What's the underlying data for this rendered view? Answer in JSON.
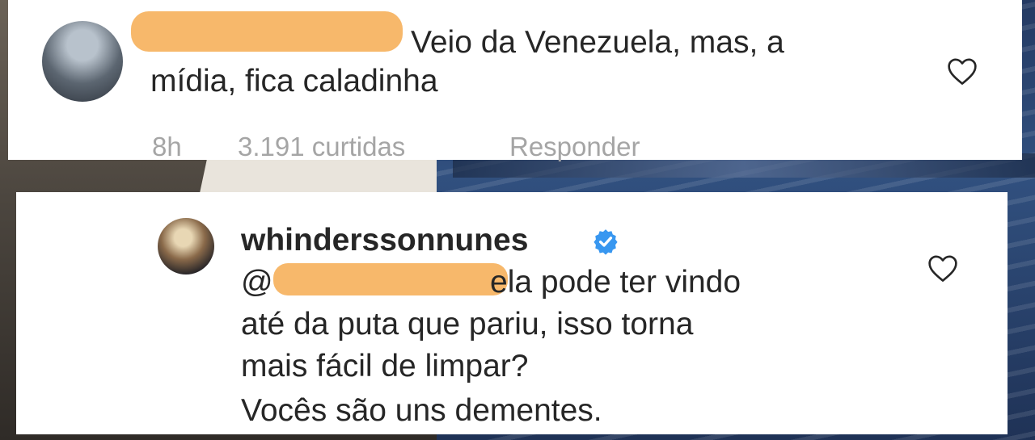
{
  "comment1": {
    "text_line1": "Veio da Venezuela, mas, a",
    "text_line2": "mídia, fica caladinha",
    "time": "8h",
    "likes": "3.191 curtidas",
    "reply": "Responder",
    "like_icon": "heart-outline-icon"
  },
  "comment2": {
    "username": "whinderssonnunes",
    "verified_icon": "verified-badge-icon",
    "mention_prefix": "@",
    "line1_rest": "ela pode ter vindo",
    "line2": "até da puta que pariu, isso torna",
    "line3": "mais fácil de limpar?",
    "line4": "Vocês são uns dementes.",
    "like_icon": "heart-outline-icon"
  },
  "colors": {
    "redaction": "#f7b86b",
    "text": "#262626",
    "meta": "#a5a5a5",
    "verified": "#3897f0"
  }
}
